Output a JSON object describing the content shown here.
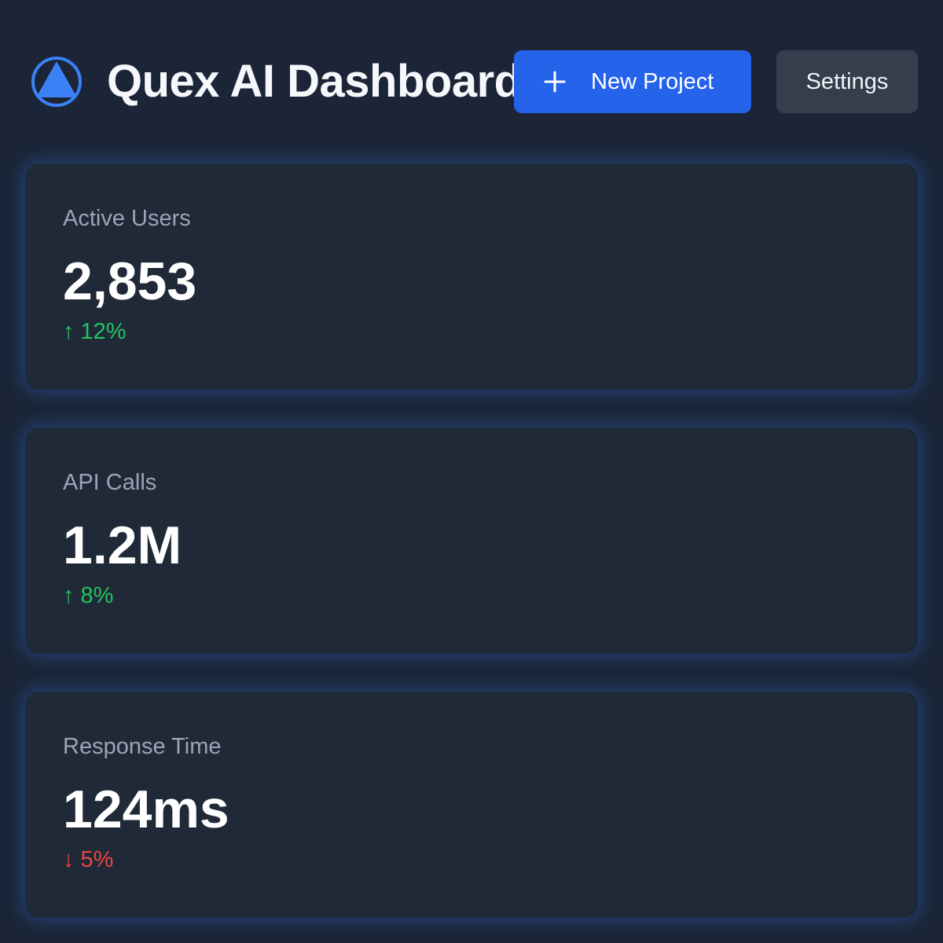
{
  "header": {
    "title": "Quex AI Dashboard",
    "logo_icon": "triangle-in-circle-logo-icon",
    "new_project_label": "New Project",
    "new_project_icon": "plus-icon",
    "settings_label": "Settings"
  },
  "colors": {
    "background": "#1b2537",
    "card": "#1f2937",
    "accent": "#2563eb",
    "logo": "#3b82f6",
    "positive": "#22c55e",
    "negative": "#ef4444"
  },
  "metrics": [
    {
      "label": "Active Users",
      "value": "2,853",
      "arrow": "↑",
      "change": "12%",
      "trend": "up"
    },
    {
      "label": "API Calls",
      "value": "1.2M",
      "arrow": "↑",
      "change": "8%",
      "trend": "up"
    },
    {
      "label": "Response Time",
      "value": "124ms",
      "arrow": "↓",
      "change": "5%",
      "trend": "down"
    }
  ]
}
